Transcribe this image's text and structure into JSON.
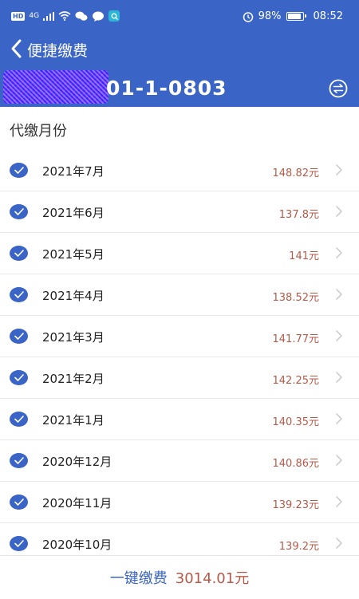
{
  "status_bar": {
    "hd": "HD",
    "network": "4G",
    "battery": "98%",
    "time": "08:52"
  },
  "header": {
    "title": "便捷缴费",
    "address_visible": "01-1-0803"
  },
  "section_title": "代缴月份",
  "months": [
    {
      "label": "2021年7月",
      "amount": "148.82元",
      "checked": true
    },
    {
      "label": "2021年6月",
      "amount": "137.8元",
      "checked": true
    },
    {
      "label": "2021年5月",
      "amount": "141元",
      "checked": true
    },
    {
      "label": "2021年4月",
      "amount": "138.52元",
      "checked": true
    },
    {
      "label": "2021年3月",
      "amount": "141.77元",
      "checked": true
    },
    {
      "label": "2021年2月",
      "amount": "142.25元",
      "checked": true
    },
    {
      "label": "2021年1月",
      "amount": "140.35元",
      "checked": true
    },
    {
      "label": "2020年12月",
      "amount": "140.86元",
      "checked": true
    },
    {
      "label": "2020年11月",
      "amount": "139.23元",
      "checked": true
    },
    {
      "label": "2020年10月",
      "amount": "139.2元",
      "checked": true
    }
  ],
  "footer": {
    "pay_label": "一键缴费",
    "total": "3014.01元"
  },
  "icons": {
    "back": "chevron-left-icon",
    "switch": "swap-icon",
    "check": "check-circle-icon",
    "row_arrow": "chevron-right-icon"
  },
  "colors": {
    "primary": "#3a64c6",
    "amount": "#b45a48"
  }
}
